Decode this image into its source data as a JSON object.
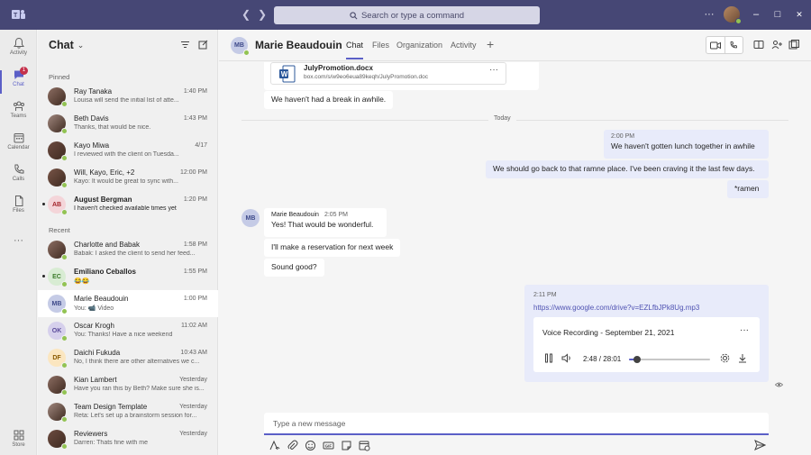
{
  "titlebar": {
    "search_placeholder": "Search or type a command",
    "more_label": "···",
    "minimize": "–",
    "maximize": "□",
    "close": "✕",
    "accent": "#464775"
  },
  "rail": {
    "items": [
      {
        "label": "Activity",
        "icon": "bell-icon"
      },
      {
        "label": "Chat",
        "icon": "chat-icon",
        "badge": "1"
      },
      {
        "label": "Teams",
        "icon": "teams-icon"
      },
      {
        "label": "Calendar",
        "icon": "calendar-icon"
      },
      {
        "label": "Calls",
        "icon": "phone-icon"
      },
      {
        "label": "Files",
        "icon": "file-icon"
      }
    ],
    "more": "···",
    "store": "Store"
  },
  "chatlist": {
    "title": "Chat",
    "pinned_label": "Pinned",
    "recent_label": "Recent",
    "pinned": [
      {
        "name": "Ray Tanaka",
        "time": "1:40 PM",
        "preview": "Louisa will send the initial list of atte...",
        "initials": "",
        "photo": true
      },
      {
        "name": "Beth Davis",
        "time": "1:43 PM",
        "preview": "Thanks, that would be nice.",
        "initials": "",
        "photo": true
      },
      {
        "name": "Kayo Miwa",
        "time": "4/17",
        "preview": "I reviewed with the client on Tuesda...",
        "initials": "",
        "photo": true
      },
      {
        "name": "Will, Kayo, Eric, +2",
        "time": "12:00 PM",
        "preview": "Kayo: It would be great to sync with...",
        "initials": "",
        "photo": true
      },
      {
        "name": "August Bergman",
        "time": "1:20 PM",
        "preview": "I haven't checked available times yet",
        "initials": "AB",
        "unread": true
      }
    ],
    "recent": [
      {
        "name": "Charlotte and Babak",
        "time": "1:58 PM",
        "preview": "Babak: I asked the client to send her feed...",
        "initials": "",
        "photo": true
      },
      {
        "name": "Emiliano Ceballos",
        "time": "1:55 PM",
        "preview": "😂😂",
        "initials": "EC",
        "unread": true
      },
      {
        "name": "Marie Beaudouin",
        "time": "1:00 PM",
        "preview": "You: 📹 Video",
        "initials": "MB",
        "selected": true
      },
      {
        "name": "Oscar Krogh",
        "time": "11:02 AM",
        "preview": "You: Thanks! Have a nice weekend",
        "initials": "OK"
      },
      {
        "name": "Daichi Fukuda",
        "time": "10:43 AM",
        "preview": "No, I think there are other alternatives we c...",
        "initials": "DF"
      },
      {
        "name": "Kian Lambert",
        "time": "Yesterday",
        "preview": "Have you ran this by Beth? Make sure she is...",
        "initials": "",
        "photo": true
      },
      {
        "name": "Team Design Template",
        "time": "Yesterday",
        "preview": "Reta: Let's set up a brainstorm session for...",
        "initials": "",
        "photo": true
      },
      {
        "name": "Reviewers",
        "time": "Yesterday",
        "preview": "Darren: Thats fine with me",
        "initials": "",
        "photo": true
      }
    ]
  },
  "header": {
    "initials": "MB",
    "name": "Marie Beaudouin",
    "tabs": [
      "Chat",
      "Files",
      "Organization",
      "Activity"
    ],
    "add_tab": "+"
  },
  "messages": {
    "file": {
      "name": "JulyPromotion.docx",
      "url": "box.com/s/w9eo6eua89keqh/JulyPromotion.doc",
      "more": "···"
    },
    "old_msg": "We haven't had a break in awhile.",
    "divider": "Today",
    "mine_time": "2:00 PM",
    "mine": [
      "We haven't gotten lunch together in awhile",
      "We should go back to that ramne place. I've been craving it the last few days.",
      "*ramen"
    ],
    "their_initials": "MB",
    "their_name": "Marie Beaudouin",
    "their_time": "2:05 PM",
    "theirs": [
      "Yes! That would be wonderful.",
      "I'll make a reservation for next week",
      "Sound good?"
    ],
    "voice": {
      "time": "2:11 PM",
      "link": "https://www.google.com/drive?v=EZLfbJPk8Ug.mp3",
      "title": "Voice Recording - September 21, 2021",
      "more": "···",
      "position": "2:48 / 28:01",
      "progress_fraction": 0.1
    }
  },
  "compose": {
    "placeholder": "Type a new message"
  }
}
